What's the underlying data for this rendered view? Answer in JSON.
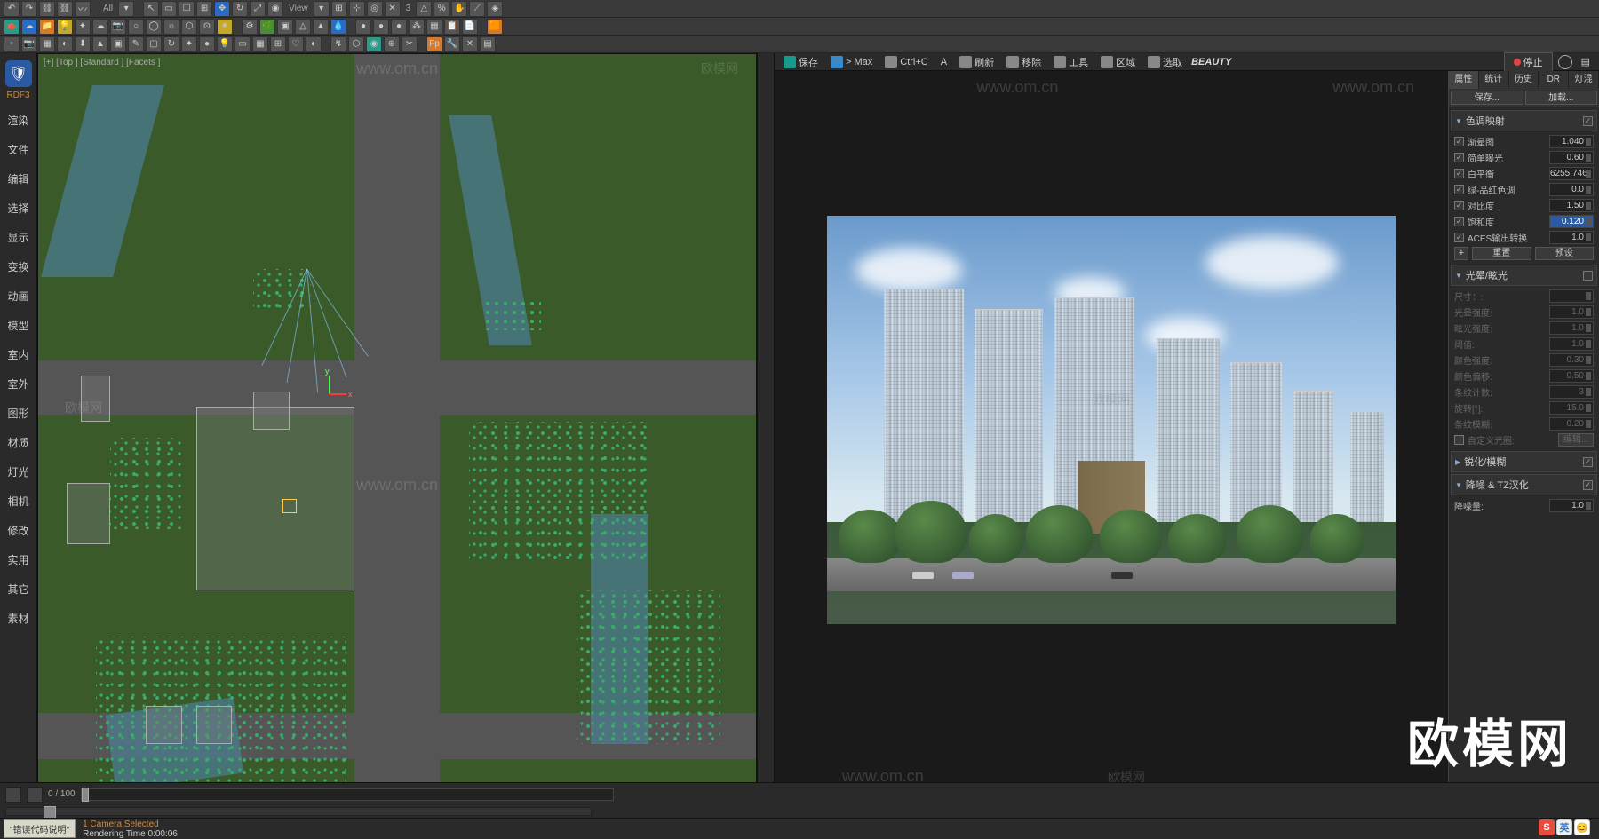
{
  "toolbarMisc": {
    "view": "View",
    "all": "All",
    "three": "3"
  },
  "leftSidebar": {
    "rdf": "RDF3",
    "items": [
      "渲染",
      "文件",
      "编辑",
      "选择",
      "显示",
      "变换",
      "动画",
      "模型",
      "室内",
      "室外",
      "图形",
      "材质",
      "灯光",
      "相机",
      "修改",
      "实用",
      "其它",
      "素材"
    ]
  },
  "viewport": {
    "label": "[+] [Top ] [Standard ] [Facets ]",
    "gizmoX": "x",
    "gizmoY": "y"
  },
  "renderToolbar": {
    "save": "保存",
    "tomax": "> Max",
    "ctrlc": "Ctrl+C",
    "refresh": "刷新",
    "move": "移除",
    "tools": "工具",
    "region": "区域",
    "select": "选取",
    "beauty": "BEAUTY",
    "stop": "停止",
    "an": "A"
  },
  "propsPanel": {
    "tabs": [
      "属性",
      "统计",
      "历史",
      "DR",
      "灯混"
    ],
    "buttons": [
      "保存...",
      "加载..."
    ],
    "rollouts": {
      "colorMapping": {
        "title": "色调映射",
        "open": true,
        "checked": true,
        "rows": [
          {
            "chk": true,
            "label": "渐晕图",
            "val": "1.040"
          },
          {
            "chk": true,
            "label": "简单曝光",
            "val": "0.60"
          },
          {
            "chk": true,
            "label": "白平衡",
            "val": "6255.746"
          },
          {
            "chk": true,
            "label": "绿-品红色调",
            "val": "0.0"
          },
          {
            "chk": true,
            "label": "对比度",
            "val": "1.50"
          },
          {
            "chk": true,
            "label": "饱和度",
            "val": "0.120",
            "selected": true
          },
          {
            "chk": true,
            "label": "ACES输出转换",
            "val": "1.0"
          }
        ],
        "btns": [
          "+",
          "重置",
          "预设"
        ]
      },
      "bloomGlare": {
        "title": "光晕/眩光",
        "open": true,
        "checked": false,
        "rows": [
          {
            "label": "尺寸：:",
            "val": "",
            "dim": true
          },
          {
            "label": "光晕强度:",
            "val": "1.0",
            "dim": true
          },
          {
            "label": "眩光强度:",
            "val": "1.0",
            "dim": true
          },
          {
            "label": "阈值:",
            "val": "1.0",
            "dim": true
          },
          {
            "label": "颜色强度:",
            "val": "0.30",
            "dim": true
          },
          {
            "label": "颜色偏移:",
            "val": "0.50",
            "dim": true
          },
          {
            "label": "条纹计数:",
            "val": "3",
            "dim": true
          },
          {
            "label": "旋转[°]:",
            "val": "15.0",
            "dim": true
          },
          {
            "label": "条纹模糊:",
            "val": "0.20",
            "dim": true
          }
        ],
        "custom": {
          "chk": false,
          "label": "自定义光圈:",
          "btn": "编辑..."
        }
      },
      "sharpen": {
        "title": "锐化/模糊",
        "open": false,
        "checked": true
      },
      "denoise": {
        "title": "降噪 & TZ汉化",
        "open": true,
        "checked": true,
        "rows": [
          {
            "label": "降噪量:",
            "val": "1.0"
          }
        ]
      }
    }
  },
  "watermarks": {
    "url": "www.om.cn",
    "brand": "欧模网",
    "small": "欧模网"
  },
  "timeline": {
    "range": "0 / 100"
  },
  "statusBar": {
    "errBtn": "\"错误代码说明\"",
    "selected": "1 Camera Selected",
    "renderTime": "Rendering Time  0:00:06"
  },
  "ime": {
    "s": "S",
    "en": "英"
  }
}
